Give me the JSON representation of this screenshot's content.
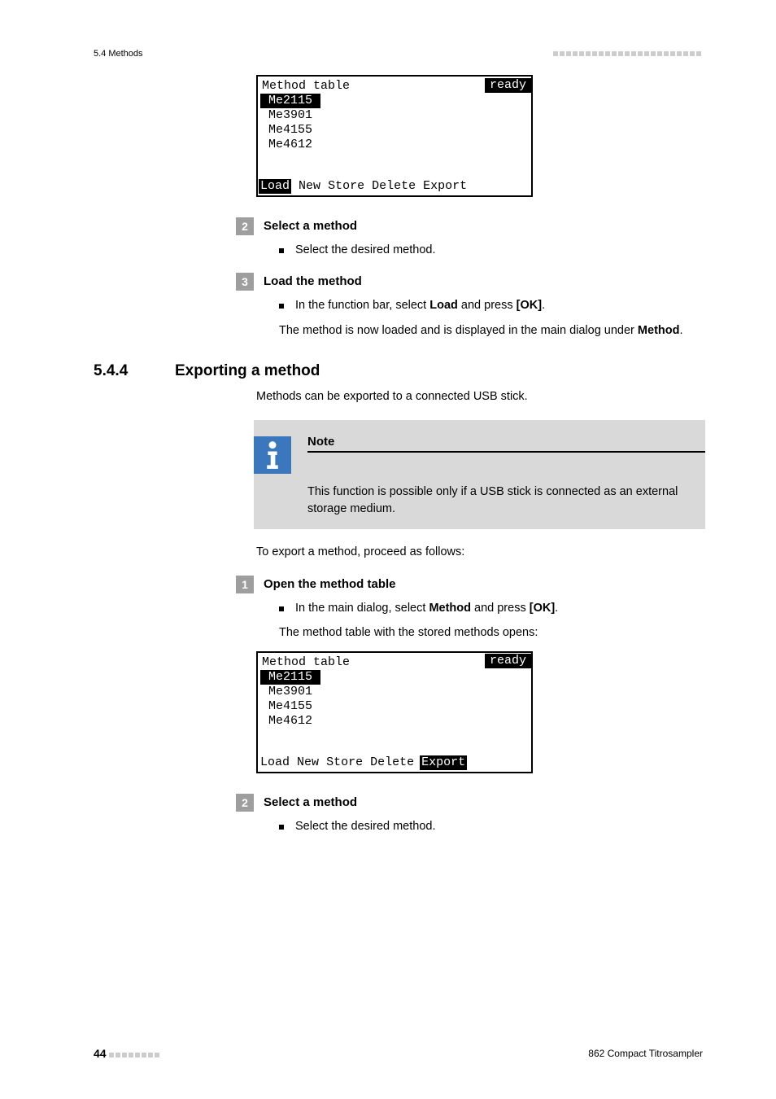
{
  "header": {
    "left": "5.4 Methods"
  },
  "lcd1": {
    "title": "Method table",
    "status": "ready",
    "items": [
      "Me2115",
      "Me3901",
      "Me4155",
      "Me4612"
    ],
    "selected_index": 0,
    "funcs": [
      "Load",
      "New",
      "Store",
      "Delete",
      "Export"
    ],
    "func_selected_index": 0
  },
  "step2": {
    "num": "2",
    "title": "Select a method",
    "bullet": "Select the desired method."
  },
  "step3": {
    "num": "3",
    "title": "Load the method",
    "bullet_pre": "In the function bar, select ",
    "bullet_b1": "Load",
    "bullet_mid": " and press ",
    "bullet_b2": "[OK]",
    "bullet_post": ".",
    "body_pre": "The method is now loaded and is displayed in the main dialog under ",
    "body_b": "Method",
    "body_post": "."
  },
  "section": {
    "num": "5.4.4",
    "title": "Exporting a method",
    "intro": "Methods can be exported to a connected USB stick."
  },
  "note": {
    "title": "Note",
    "body": "This function is possible only if a USB stick is connected as an external storage medium."
  },
  "export_intro": "To export a method, proceed as follows:",
  "step1b": {
    "num": "1",
    "title": "Open the method table",
    "bullet_pre": "In the main dialog, select ",
    "bullet_b1": "Method",
    "bullet_mid": " and press ",
    "bullet_b2": "[OK]",
    "bullet_post": ".",
    "body": "The method table with the stored methods opens:"
  },
  "lcd2": {
    "title": "Method table",
    "status": "ready",
    "items": [
      "Me2115",
      "Me3901",
      "Me4155",
      "Me4612"
    ],
    "selected_index": 0,
    "funcs": [
      "Load",
      "New",
      "Store",
      "Delete",
      "Export"
    ],
    "func_selected_index": 4
  },
  "step2b": {
    "num": "2",
    "title": "Select a method",
    "bullet": "Select the desired method."
  },
  "footer": {
    "page": "44",
    "doc": "862 Compact Titrosampler"
  }
}
